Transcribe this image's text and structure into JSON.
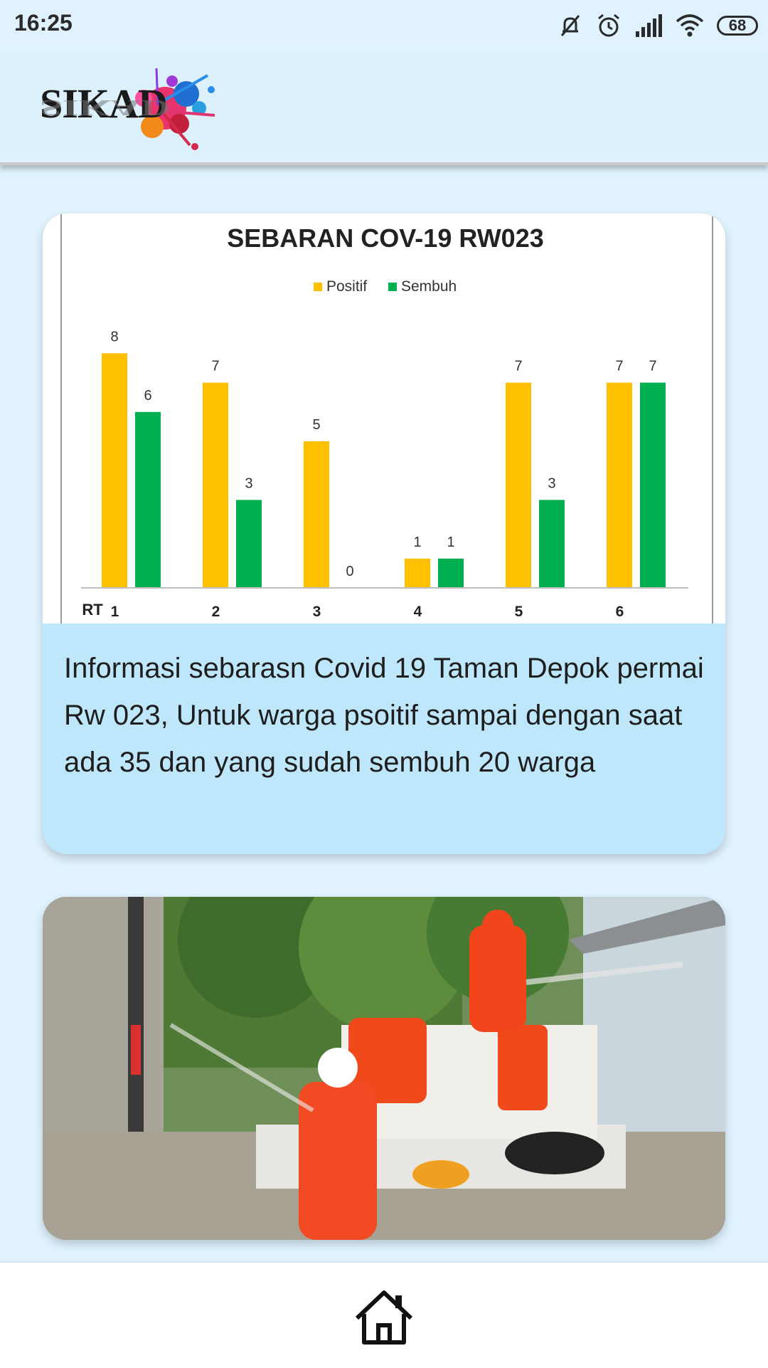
{
  "status": {
    "time": "16:25",
    "battery": "68",
    "icons": [
      "mute-icon",
      "alarm-icon",
      "signal-icon",
      "wifi-icon",
      "battery-icon"
    ]
  },
  "app": {
    "logo_text": "SIKAD"
  },
  "card1": {
    "description": "Informasi sebarasn Covid 19 Taman Depok permai Rw 023, Untuk warga psoitif sampai dengan saat ada 35 dan yang sudah sembuh 20 warga"
  },
  "chart_data": {
    "type": "bar",
    "title": "SEBARAN COV-19 RW023",
    "xlabel": "RT",
    "categories": [
      "1",
      "2",
      "3",
      "4",
      "5",
      "6"
    ],
    "series": [
      {
        "name": "Positif",
        "values": [
          8,
          7,
          5,
          1,
          7,
          7
        ],
        "color": "#FFC000"
      },
      {
        "name": "Sembuh",
        "values": [
          6,
          3,
          0,
          1,
          3,
          7
        ],
        "color": "#00B050"
      }
    ],
    "ylim": [
      0,
      8
    ],
    "grid": false,
    "legend": "top-center"
  },
  "nav": {
    "home_icon": "home-icon"
  }
}
